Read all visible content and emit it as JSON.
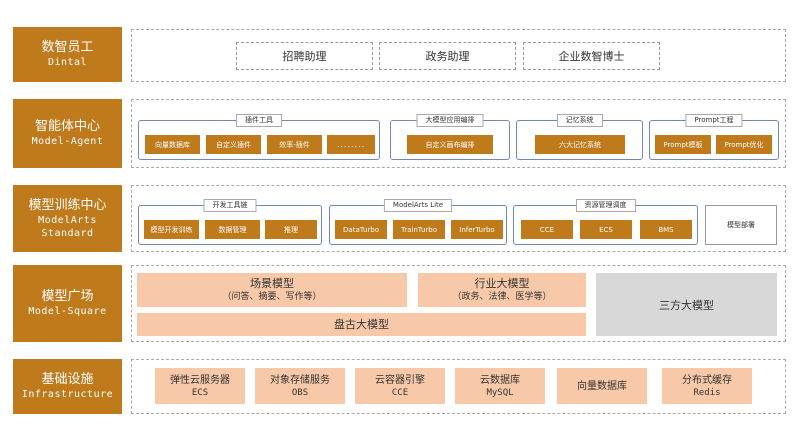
{
  "layers": {
    "dintal": {
      "label_zh": "数智员工",
      "label_en": "Dintal",
      "items": [
        "招聘助理",
        "政务助理",
        "企业数智博士"
      ]
    },
    "agent": {
      "label_zh": "智能体中心",
      "label_en": "Model-Agent",
      "groups": [
        {
          "title": "插件工具",
          "chips": [
            "向量数据库",
            "自定义插件",
            "效率-插件",
            "........"
          ]
        },
        {
          "title": "大模型应用编排",
          "chips": [
            "自定义画布编排"
          ]
        },
        {
          "title": "记忆系统",
          "chips": [
            "六大记忆系统"
          ]
        },
        {
          "title": "Prompt工程",
          "chips": [
            "Prompt模板",
            "Prompt优化"
          ]
        }
      ]
    },
    "training": {
      "label_zh": "模型训练中心",
      "label_en_1": "ModelArts",
      "label_en_2": "Standard",
      "groups": [
        {
          "title": "开发工具链",
          "chips": [
            "模型开发训练",
            "数据管理",
            "推理"
          ]
        },
        {
          "title": "ModelArts Lite",
          "chips": [
            "DataTurbo",
            "TrainTurbo",
            "InferTurbo"
          ]
        },
        {
          "title": "资源管理调度",
          "chips": [
            "CCE",
            "ECS",
            "BMS"
          ]
        }
      ],
      "deploy": "模型部署"
    },
    "square": {
      "label_zh": "模型广场",
      "label_en": "Model-Square",
      "scene": {
        "title": "场景模型",
        "sub": "（问答、摘要、写作等）"
      },
      "industry": {
        "title": "行业大模型",
        "sub": "（政务、法律、医学等）"
      },
      "pangu": "盘古大模型",
      "third": "三方大模型"
    },
    "infra": {
      "label_zh": "基础设施",
      "label_en": "Infrastructure",
      "items": [
        {
          "zh": "弹性云服务器",
          "en": "ECS"
        },
        {
          "zh": "对象存储服务",
          "en": "OBS"
        },
        {
          "zh": "云容器引擎",
          "en": "CCE"
        },
        {
          "zh": "云数据库",
          "en": "MySQL"
        },
        {
          "zh": "向量数据库",
          "en": ""
        },
        {
          "zh": "分布式缓存",
          "en": "Redis"
        }
      ]
    }
  }
}
